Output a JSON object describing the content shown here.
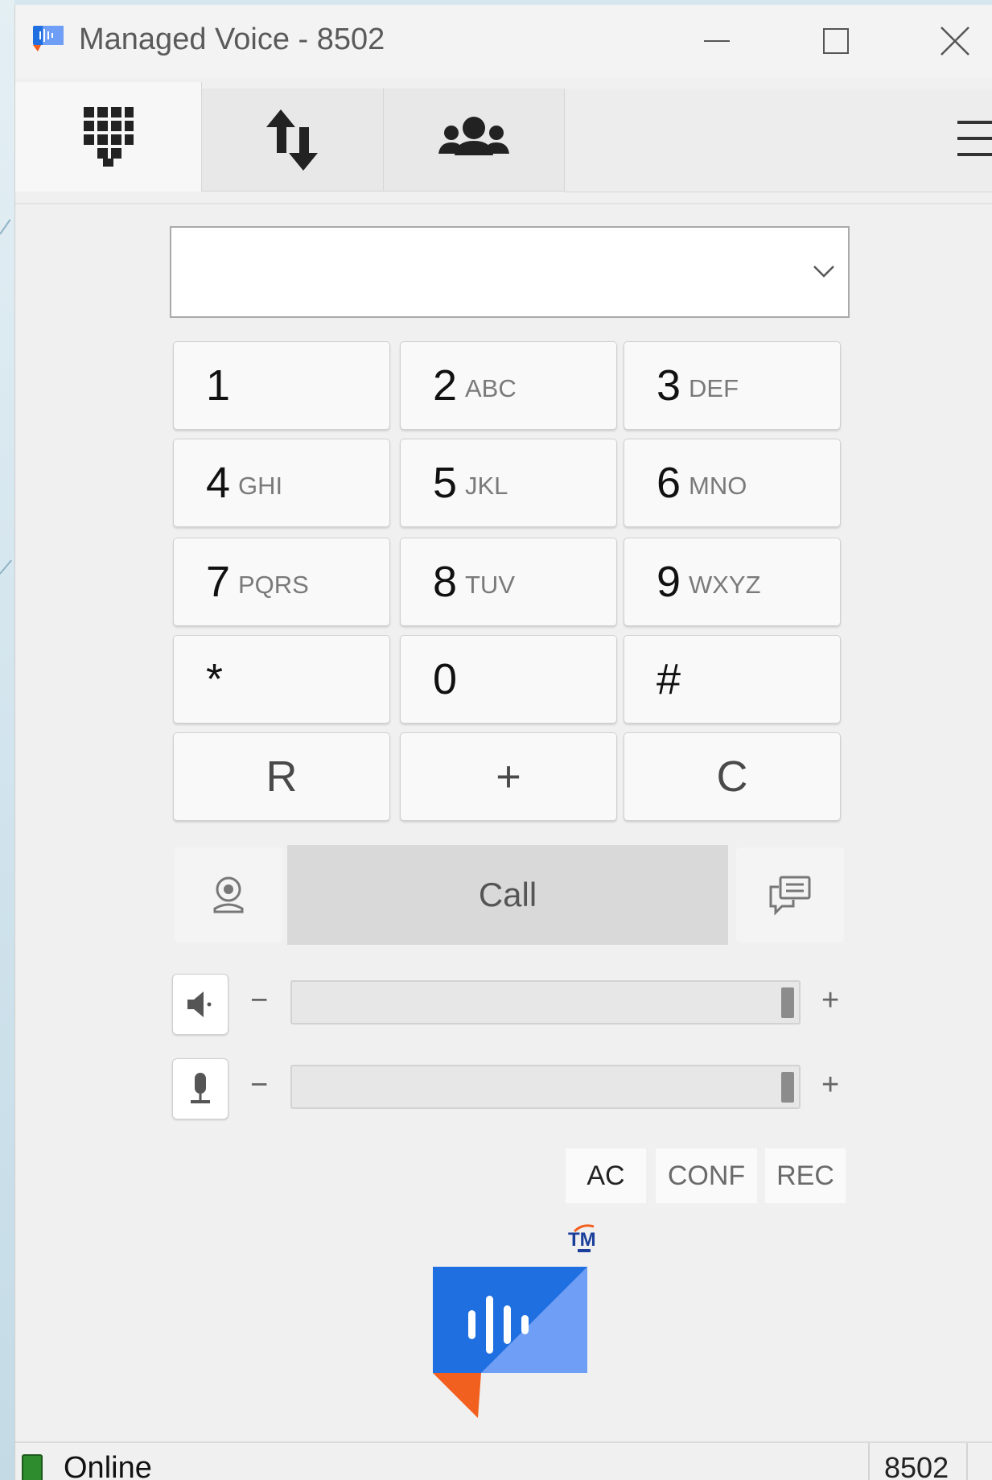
{
  "window": {
    "title": "Managed Voice - 8502",
    "minimize_icon": "minimize-icon",
    "maximize_icon": "maximize-icon",
    "close_icon": "close-icon"
  },
  "tabs": [
    {
      "name": "dialpad",
      "icon": "dialpad-icon",
      "active": true
    },
    {
      "name": "transfer",
      "icon": "transfer-arrows-icon",
      "active": false
    },
    {
      "name": "contacts",
      "icon": "contacts-group-icon",
      "active": false
    }
  ],
  "menu_icon": "hamburger-menu-icon",
  "number_input": {
    "value": "",
    "dropdown_icon": "chevron-down-icon"
  },
  "keypad": [
    {
      "digit": "1",
      "letters": ""
    },
    {
      "digit": "2",
      "letters": "ABC"
    },
    {
      "digit": "3",
      "letters": "DEF"
    },
    {
      "digit": "4",
      "letters": "GHI"
    },
    {
      "digit": "5",
      "letters": "JKL"
    },
    {
      "digit": "6",
      "letters": "MNO"
    },
    {
      "digit": "7",
      "letters": "PQRS"
    },
    {
      "digit": "8",
      "letters": "TUV"
    },
    {
      "digit": "9",
      "letters": "WXYZ"
    },
    {
      "digit": "*",
      "letters": ""
    },
    {
      "digit": "0",
      "letters": ""
    },
    {
      "digit": "#",
      "letters": ""
    },
    {
      "digit": "R",
      "letters": ""
    },
    {
      "digit": "+",
      "letters": ""
    },
    {
      "digit": "C",
      "letters": ""
    }
  ],
  "actions": {
    "video_icon": "webcam-icon",
    "call_label": "Call",
    "message_icon": "chat-bubbles-icon"
  },
  "speaker": {
    "icon": "speaker-icon",
    "minus": "−",
    "plus": "+",
    "level": 1.0
  },
  "microphone": {
    "icon": "microphone-icon",
    "minus": "−",
    "plus": "+",
    "level": 1.0
  },
  "toggles": [
    {
      "label": "AC",
      "active": true
    },
    {
      "label": "CONF",
      "active": false
    },
    {
      "label": "REC",
      "active": false
    }
  ],
  "logo": {
    "badge": "TM",
    "icon": "managed-voice-logo"
  },
  "status": {
    "text": "Online",
    "extension": "8502",
    "color": "#2e8b2e"
  },
  "colors": {
    "logo_blue": "#1f6fe0",
    "logo_light": "#6e9ef5",
    "logo_orange": "#f2601f"
  }
}
